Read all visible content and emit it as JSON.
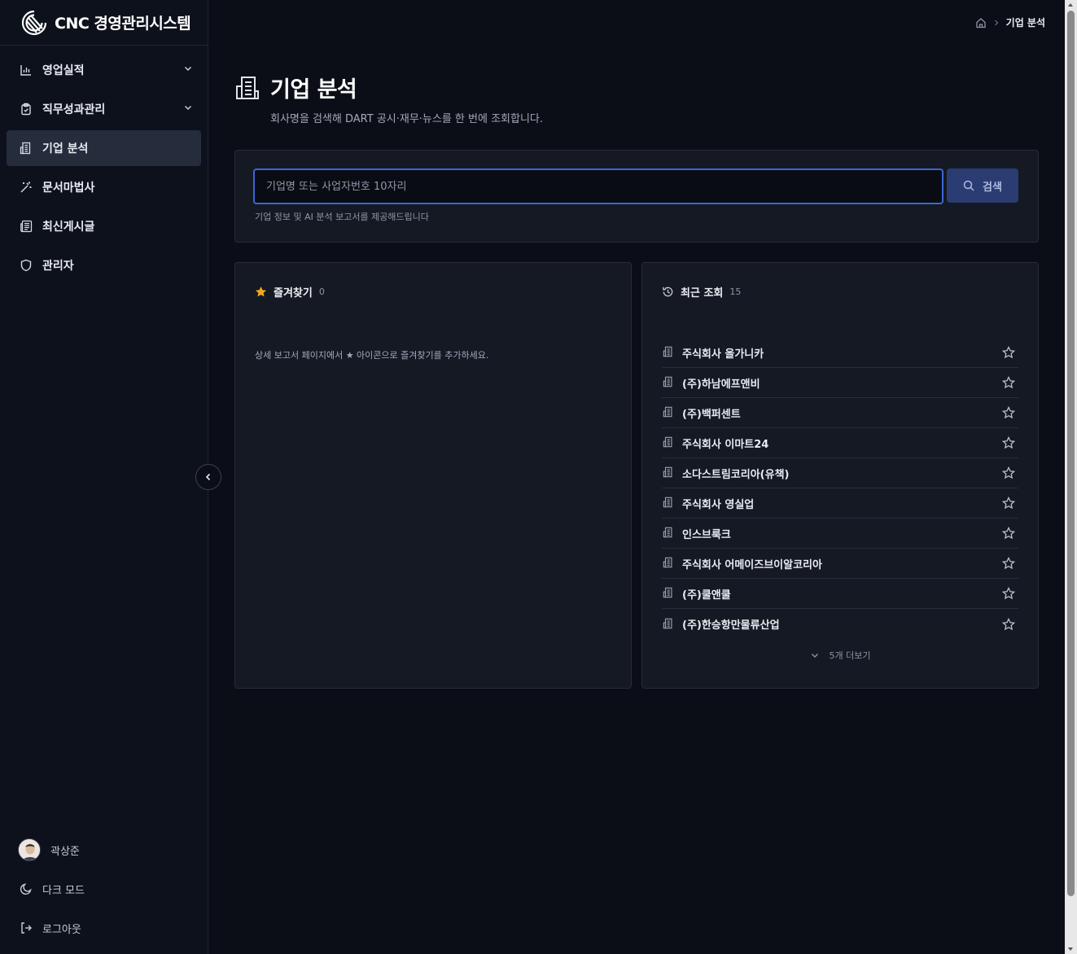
{
  "brand": {
    "name": "CNC 경영관리시스템",
    "logo_icon": "cnc-logo"
  },
  "sidebar": {
    "items": [
      {
        "label": "영업실적",
        "icon": "bar-chart-icon",
        "expandable": true
      },
      {
        "label": "직무성과관리",
        "icon": "clipboard-check-icon",
        "expandable": true
      },
      {
        "label": "기업 분석",
        "icon": "building-icon",
        "active": true
      },
      {
        "label": "문서마법사",
        "icon": "magic-wand-icon"
      },
      {
        "label": "최신게시글",
        "icon": "newspaper-icon"
      },
      {
        "label": "관리자",
        "icon": "shield-icon"
      }
    ],
    "user": {
      "name": "곽상준"
    },
    "dark_mode_label": "다크 모드",
    "logout_label": "로그아웃"
  },
  "breadcrumb": {
    "current": "기업 분석"
  },
  "page": {
    "title": "기업 분석",
    "subtitle": "회사명을 검색해 DART 공시·재무·뉴스를 한 번에 조회합니다."
  },
  "search": {
    "placeholder": "기업명 또는 사업자번호 10자리",
    "value": "",
    "button_label": "검색",
    "hint": "기업 정보 및 AI 분석 보고서를 제공해드립니다"
  },
  "favorites": {
    "title": "즐겨찾기",
    "count": "0",
    "empty_message": "상세 보고서 페이지에서 ★ 아이콘으로 즐겨찾기를 추가하세요."
  },
  "recent": {
    "title": "최근 조회",
    "count": "15",
    "items": [
      "주식회사 올가니카",
      "(주)하남에프앤비",
      "(주)백퍼센트",
      "주식회사 이마트24",
      "소다스트림코리아(유책)",
      "주식회사 영실업",
      "인스브룩크",
      "주식회사 어메이즈브이알코리아",
      "(주)쿨앤쿨",
      "(주)한승항만물류산업"
    ],
    "more_label": "5개 더보기"
  },
  "colors": {
    "background": "#0b0e17",
    "sidebar": "#0d111b",
    "card": "#141923",
    "accent": "#3c66d6",
    "star": "#f5a623"
  }
}
